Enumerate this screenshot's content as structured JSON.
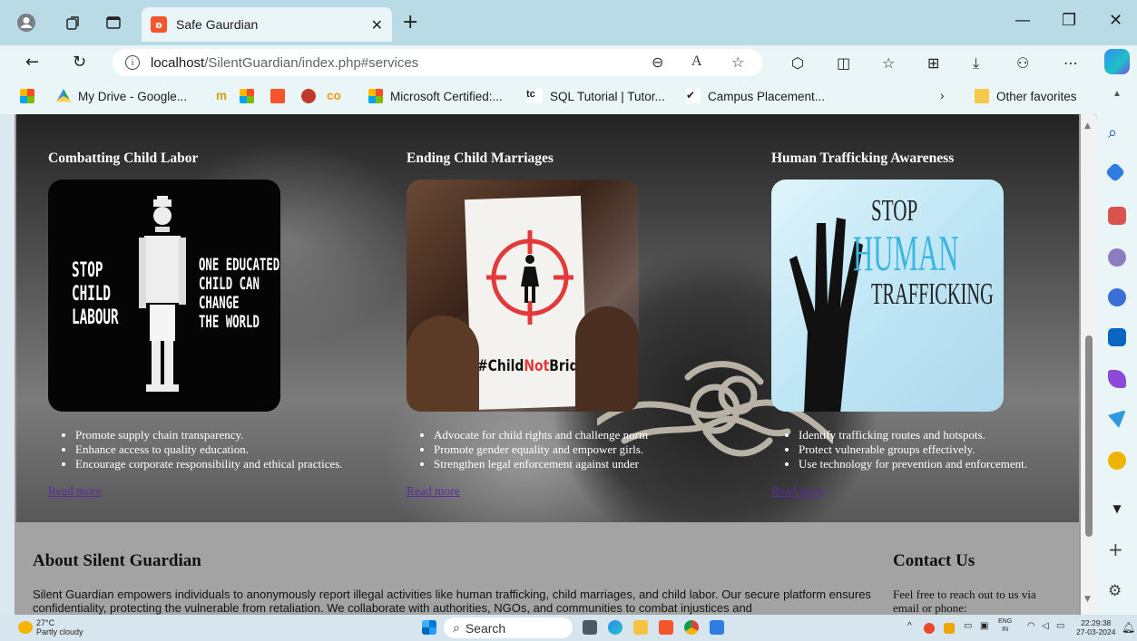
{
  "browser": {
    "tab_title": "Safe Gaurdian",
    "url_host": "localhost",
    "url_path": "/SilentGuardian/index.php#services",
    "favorites": [
      {
        "label": "My Drive - Google..."
      },
      {
        "label": "Microsoft Certified:..."
      },
      {
        "label": "SQL Tutorial | Tutor..."
      },
      {
        "label": "Campus Placement..."
      }
    ],
    "other_favorites": "Other favorites"
  },
  "services": [
    {
      "title": "Combatting Child Labor",
      "image_text": {
        "left": "STOP\nCHILD\nLABOUR",
        "right": "ONE EDUCATED\nCHILD CAN\nCHANGE\nTHE WORLD"
      },
      "points": [
        "Promote supply chain transparency.",
        "Enhance access to quality education.",
        "Encourage corporate responsibility and ethical practices."
      ],
      "link": "Read more"
    },
    {
      "title": "Ending Child Marriages",
      "image_text": {
        "hashtag_pre": "#Child",
        "hashtag_mid": "Not",
        "hashtag_post": "Bride"
      },
      "points": [
        "Advocate for child rights and challenge norm",
        "Promote gender equality and empower girls.",
        "Strengthen legal enforcement against under"
      ],
      "link": "Read more"
    },
    {
      "title": "Human Trafficking Awareness",
      "image_text": {
        "l1": "STOP",
        "l2": "HUMAN",
        "l3": "TRAFFICKING"
      },
      "points": [
        "Identify trafficking routes and hotspots.",
        "Protect vulnerable groups effectively.",
        "Use technology for prevention and enforcement."
      ],
      "link": "Read more"
    }
  ],
  "about": {
    "heading": "About Silent Guardian",
    "text": "Silent Guardian empowers individuals to anonymously report illegal activities like human trafficking, child marriages, and child labor. Our secure platform ensures confidentiality, protecting the vulnerable from retaliation. We collaborate with authorities, NGOs, and communities to combat injustices and"
  },
  "contact": {
    "heading": "Contact Us",
    "text": "Feel free to reach out to us via email or phone:"
  },
  "taskbar": {
    "temp": "27°C",
    "weather": "Partly cloudy",
    "search": "Search",
    "lang1": "ENG",
    "lang2": "IN",
    "time": "22:29:38",
    "date": "27-03-2024"
  },
  "colors": {
    "link": "#5a2ca0",
    "chrome": "#b9dbe5",
    "toolbar": "#eaf5f8"
  }
}
